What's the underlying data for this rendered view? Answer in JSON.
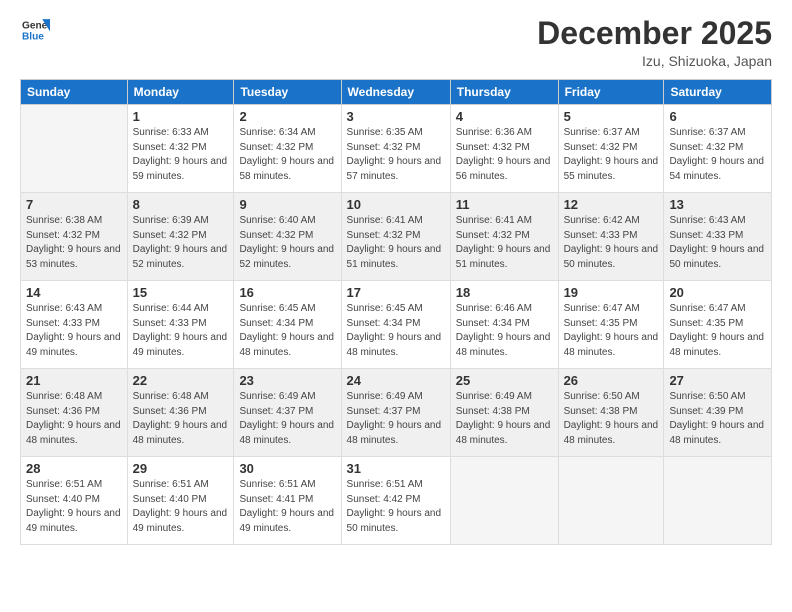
{
  "header": {
    "logo_line1": "General",
    "logo_line2": "Blue",
    "month": "December 2025",
    "location": "Izu, Shizuoka, Japan"
  },
  "weekdays": [
    "Sunday",
    "Monday",
    "Tuesday",
    "Wednesday",
    "Thursday",
    "Friday",
    "Saturday"
  ],
  "weeks": [
    [
      {
        "day": "",
        "empty": true
      },
      {
        "day": "1",
        "sunrise": "6:33 AM",
        "sunset": "4:32 PM",
        "daylight": "9 hours and 59 minutes."
      },
      {
        "day": "2",
        "sunrise": "6:34 AM",
        "sunset": "4:32 PM",
        "daylight": "9 hours and 58 minutes."
      },
      {
        "day": "3",
        "sunrise": "6:35 AM",
        "sunset": "4:32 PM",
        "daylight": "9 hours and 57 minutes."
      },
      {
        "day": "4",
        "sunrise": "6:36 AM",
        "sunset": "4:32 PM",
        "daylight": "9 hours and 56 minutes."
      },
      {
        "day": "5",
        "sunrise": "6:37 AM",
        "sunset": "4:32 PM",
        "daylight": "9 hours and 55 minutes."
      },
      {
        "day": "6",
        "sunrise": "6:37 AM",
        "sunset": "4:32 PM",
        "daylight": "9 hours and 54 minutes."
      }
    ],
    [
      {
        "day": "7",
        "sunrise": "6:38 AM",
        "sunset": "4:32 PM",
        "daylight": "9 hours and 53 minutes."
      },
      {
        "day": "8",
        "sunrise": "6:39 AM",
        "sunset": "4:32 PM",
        "daylight": "9 hours and 52 minutes."
      },
      {
        "day": "9",
        "sunrise": "6:40 AM",
        "sunset": "4:32 PM",
        "daylight": "9 hours and 52 minutes."
      },
      {
        "day": "10",
        "sunrise": "6:41 AM",
        "sunset": "4:32 PM",
        "daylight": "9 hours and 51 minutes."
      },
      {
        "day": "11",
        "sunrise": "6:41 AM",
        "sunset": "4:32 PM",
        "daylight": "9 hours and 51 minutes."
      },
      {
        "day": "12",
        "sunrise": "6:42 AM",
        "sunset": "4:33 PM",
        "daylight": "9 hours and 50 minutes."
      },
      {
        "day": "13",
        "sunrise": "6:43 AM",
        "sunset": "4:33 PM",
        "daylight": "9 hours and 50 minutes."
      }
    ],
    [
      {
        "day": "14",
        "sunrise": "6:43 AM",
        "sunset": "4:33 PM",
        "daylight": "9 hours and 49 minutes."
      },
      {
        "day": "15",
        "sunrise": "6:44 AM",
        "sunset": "4:33 PM",
        "daylight": "9 hours and 49 minutes."
      },
      {
        "day": "16",
        "sunrise": "6:45 AM",
        "sunset": "4:34 PM",
        "daylight": "9 hours and 48 minutes."
      },
      {
        "day": "17",
        "sunrise": "6:45 AM",
        "sunset": "4:34 PM",
        "daylight": "9 hours and 48 minutes."
      },
      {
        "day": "18",
        "sunrise": "6:46 AM",
        "sunset": "4:34 PM",
        "daylight": "9 hours and 48 minutes."
      },
      {
        "day": "19",
        "sunrise": "6:47 AM",
        "sunset": "4:35 PM",
        "daylight": "9 hours and 48 minutes."
      },
      {
        "day": "20",
        "sunrise": "6:47 AM",
        "sunset": "4:35 PM",
        "daylight": "9 hours and 48 minutes."
      }
    ],
    [
      {
        "day": "21",
        "sunrise": "6:48 AM",
        "sunset": "4:36 PM",
        "daylight": "9 hours and 48 minutes."
      },
      {
        "day": "22",
        "sunrise": "6:48 AM",
        "sunset": "4:36 PM",
        "daylight": "9 hours and 48 minutes."
      },
      {
        "day": "23",
        "sunrise": "6:49 AM",
        "sunset": "4:37 PM",
        "daylight": "9 hours and 48 minutes."
      },
      {
        "day": "24",
        "sunrise": "6:49 AM",
        "sunset": "4:37 PM",
        "daylight": "9 hours and 48 minutes."
      },
      {
        "day": "25",
        "sunrise": "6:49 AM",
        "sunset": "4:38 PM",
        "daylight": "9 hours and 48 minutes."
      },
      {
        "day": "26",
        "sunrise": "6:50 AM",
        "sunset": "4:38 PM",
        "daylight": "9 hours and 48 minutes."
      },
      {
        "day": "27",
        "sunrise": "6:50 AM",
        "sunset": "4:39 PM",
        "daylight": "9 hours and 48 minutes."
      }
    ],
    [
      {
        "day": "28",
        "sunrise": "6:51 AM",
        "sunset": "4:40 PM",
        "daylight": "9 hours and 49 minutes."
      },
      {
        "day": "29",
        "sunrise": "6:51 AM",
        "sunset": "4:40 PM",
        "daylight": "9 hours and 49 minutes."
      },
      {
        "day": "30",
        "sunrise": "6:51 AM",
        "sunset": "4:41 PM",
        "daylight": "9 hours and 49 minutes."
      },
      {
        "day": "31",
        "sunrise": "6:51 AM",
        "sunset": "4:42 PM",
        "daylight": "9 hours and 50 minutes."
      },
      {
        "day": "",
        "empty": true
      },
      {
        "day": "",
        "empty": true
      },
      {
        "day": "",
        "empty": true
      }
    ]
  ],
  "labels": {
    "sunrise": "Sunrise:",
    "sunset": "Sunset:",
    "daylight": "Daylight:"
  }
}
